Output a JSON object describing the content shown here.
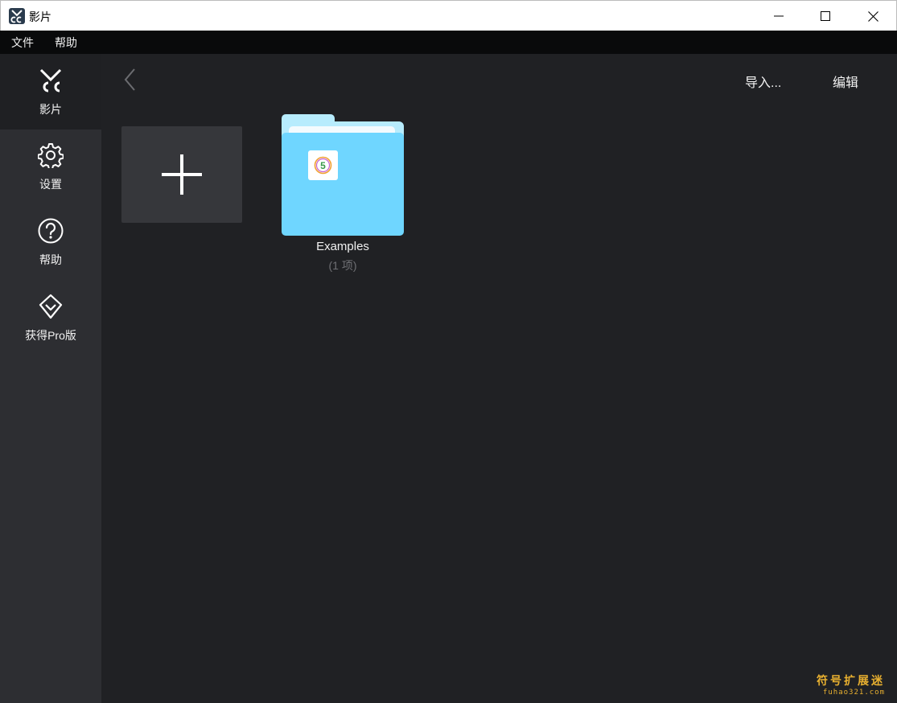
{
  "window": {
    "title": "影片"
  },
  "menu": {
    "items": [
      "文件",
      "帮助"
    ]
  },
  "sidebar": {
    "items": [
      {
        "label": "影片",
        "icon": "scissors-cc-icon",
        "active": true
      },
      {
        "label": "设置",
        "icon": "gear-icon"
      },
      {
        "label": "帮助",
        "icon": "help-circle-icon"
      },
      {
        "label": "获得Pro版",
        "icon": "diamond-icon"
      }
    ]
  },
  "toolbar": {
    "import_label": "导入...",
    "edit_label": "编辑"
  },
  "content": {
    "new_tile_icon": "plus-icon",
    "folders": [
      {
        "name": "Examples",
        "count": "(1 项)",
        "color": "#6fd6ff"
      }
    ]
  },
  "watermark": {
    "line1": "符号扩展迷",
    "line2": "fuhao321.com"
  },
  "colors": {
    "background": "#202124",
    "sidebar": "#2d2e32",
    "folder": "#6fd6ff"
  }
}
